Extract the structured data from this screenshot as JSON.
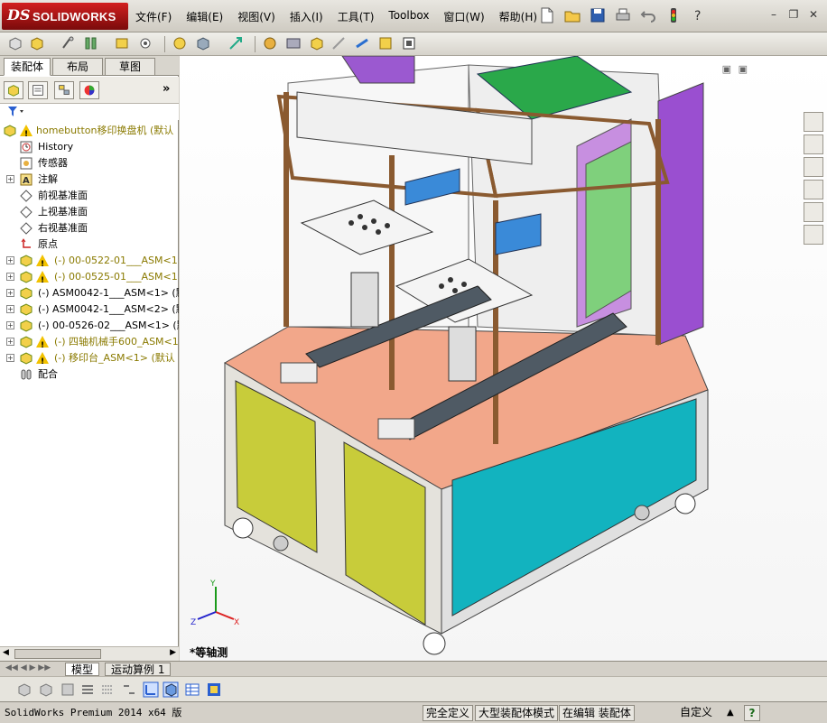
{
  "app": {
    "brand_ds": "DS",
    "brand_name": "SOLIDWORKS"
  },
  "menu": [
    "文件(F)",
    "编辑(E)",
    "视图(V)",
    "插入(I)",
    "工具(T)",
    "Toolbox",
    "窗口(W)",
    "帮助(H)"
  ],
  "left_panel": {
    "tabs": [
      "装配体",
      "布局",
      "草图"
    ],
    "tree": [
      {
        "label": "homebutton移印换盘机 (默认",
        "icon": "assembly-warn-icon",
        "color": "olive",
        "indent": 0
      },
      {
        "label": "History",
        "icon": "history-icon",
        "indent": 1
      },
      {
        "label": "传感器",
        "icon": "sensor-icon",
        "indent": 1
      },
      {
        "label": "注解",
        "icon": "annotation-icon",
        "indent": 1,
        "expand": true
      },
      {
        "label": "前视基准面",
        "icon": "plane-icon",
        "indent": 1
      },
      {
        "label": "上视基准面",
        "icon": "plane-icon",
        "indent": 1
      },
      {
        "label": "右视基准面",
        "icon": "plane-icon",
        "indent": 1
      },
      {
        "label": "原点",
        "icon": "origin-icon",
        "indent": 1
      },
      {
        "label": "(-) 00-0522-01___ASM<1>",
        "icon": "assembly-warn-icon",
        "color": "olive",
        "indent": 1,
        "expand": true
      },
      {
        "label": "(-) 00-0525-01___ASM<1>",
        "icon": "assembly-warn-icon",
        "color": "olive",
        "indent": 1,
        "expand": true
      },
      {
        "label": "(-) ASM0042-1___ASM<1> (默",
        "icon": "assembly-icon",
        "indent": 1,
        "expand": true
      },
      {
        "label": "(-) ASM0042-1___ASM<2> (默",
        "icon": "assembly-icon",
        "indent": 1,
        "expand": true
      },
      {
        "label": "(-) 00-0526-02___ASM<1> (默",
        "icon": "assembly-icon",
        "indent": 1,
        "expand": true
      },
      {
        "label": "(-) 四轴机械手600_ASM<1>",
        "icon": "assembly-warn-icon",
        "color": "olive",
        "indent": 1,
        "expand": true
      },
      {
        "label": "(-) 移印台_ASM<1> (默认",
        "icon": "assembly-warn-icon",
        "color": "olive",
        "indent": 1,
        "expand": true
      },
      {
        "label": "配合",
        "icon": "mates-icon",
        "indent": 1
      }
    ]
  },
  "graphics": {
    "view_label": "*等轴测",
    "axis_y": "Y",
    "axis_x": "X",
    "axis_z": "Z"
  },
  "bottom_tabs": [
    "模型",
    "运动算例 1"
  ],
  "status": {
    "product": "SolidWorks Premium 2014 x64 版",
    "defined": "完全定义",
    "mode": "大型装配体模式",
    "editing": "在编辑 装配体",
    "custom": "自定义"
  }
}
